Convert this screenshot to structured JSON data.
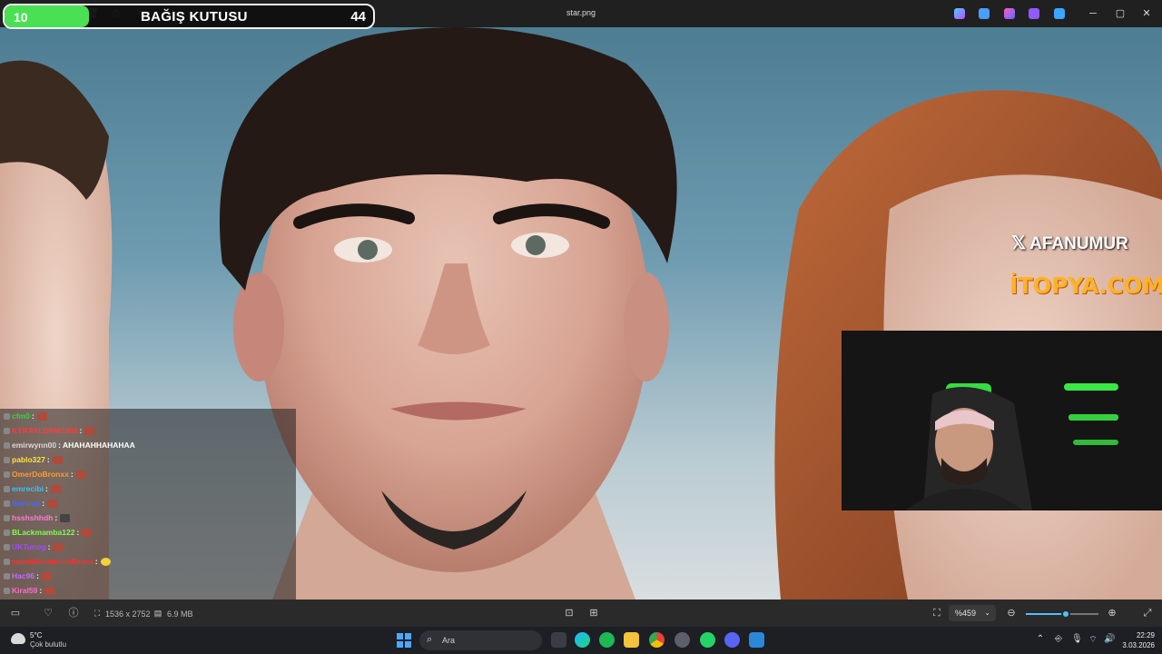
{
  "window": {
    "title": "star.png",
    "left_icons": [
      "trash-icon",
      "print-icon",
      "crop-icon"
    ],
    "app_icons": [
      "copilot-icon",
      "edit-icon",
      "designer-icon",
      "clipchamp-icon",
      "cloud-icon"
    ],
    "controls": {
      "minimize": "─",
      "maximize": "▢",
      "close": "✕"
    }
  },
  "donation_box": {
    "title": "BAĞIŞ KUTUSU",
    "current": "10",
    "amount": "44",
    "progress_fraction": 0.23,
    "fill_color": "#4be054"
  },
  "sponsors": {
    "x_handle": "AFANUMUR",
    "site": "İTOPYA.COM",
    "site_color": "#ffb12a"
  },
  "chat": {
    "messages": [
      {
        "user": "cfm0",
        "text": ":",
        "color": "#3ed23e",
        "emote": "e1"
      },
      {
        "user": "KYRAYLDRM1905",
        "text": ":",
        "color": "#ff3b3b",
        "emote": "e1"
      },
      {
        "user": "emirwynn00",
        "text": ": AHAHAHHAHAHAA",
        "color": "#d9d9d9",
        "emote": ""
      },
      {
        "user": "pablo327",
        "text": ":",
        "color": "#ffe33b",
        "emote": "e1"
      },
      {
        "user": "OmerDoBronxx",
        "text": ":",
        "color": "#ff9a2e",
        "emote": "e1"
      },
      {
        "user": "emrecibi",
        "text": ":",
        "color": "#33c4ff",
        "emote": "e1"
      },
      {
        "user": "Beniray",
        "text": ":",
        "color": "#3f6bff",
        "emote": "e1"
      },
      {
        "user": "hsshshhdh",
        "text": ":",
        "color": "#ff7ad9",
        "emote": "e2"
      },
      {
        "user": "BLackmamba122",
        "text": ":",
        "color": "#7dff4a",
        "emote": "e1"
      },
      {
        "user": "UKTunog",
        "text": ":",
        "color": "#a24bff",
        "emote": "e1"
      },
      {
        "user": "specialistadelcaffeacs",
        "text": ":",
        "color": "#ff2e2e",
        "emote": "e3"
      },
      {
        "user": "Hac96",
        "text": ":",
        "color": "#c26bff",
        "emote": "e1"
      },
      {
        "user": "Kiral59",
        "text": ":",
        "color": "#ff6bd6",
        "emote": "e1"
      }
    ]
  },
  "statusbar": {
    "dimensions": "1536 x 2752",
    "file_size": "6.9 MB",
    "zoom": "%459",
    "zoom_slider_fraction": 0.55
  },
  "taskbar": {
    "weather_temp": "5°C",
    "weather_desc": "Çok bulutlu",
    "search_placeholder": "Ara",
    "time": "22:29",
    "date": "3.03.2026"
  }
}
